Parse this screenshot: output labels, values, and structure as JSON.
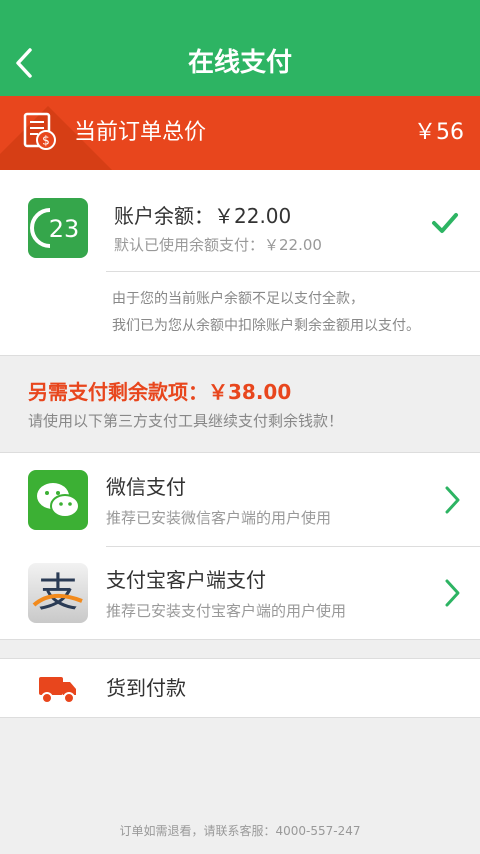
{
  "header": {
    "title": "在线支付"
  },
  "order": {
    "label": "当前订单总价",
    "amount": "￥56"
  },
  "balance": {
    "line1": "账户余额：￥22.00",
    "line2": "默认已使用余额支付：￥22.00",
    "note1": "由于您的当前账户余额不足以支付全款，",
    "note2": "我们已为您从余额中扣除账户剩余金额用以支付。"
  },
  "remaining": {
    "title": "另需支付剩余款项：￥38.00",
    "subtitle": "请使用以下第三方支付工具继续支付剩余钱款！"
  },
  "payment_methods": [
    {
      "name": "微信支付",
      "desc": "推荐已安装微信客户端的用户使用"
    },
    {
      "name": "支付宝客户端支付",
      "desc": "推荐已安装支付宝客户端的用户使用"
    }
  ],
  "cod": {
    "label": "货到付款"
  },
  "footer": {
    "text": "订单如需退看，请联系客服：4000-557-247"
  },
  "colors": {
    "primary_green": "#2db463",
    "accent_orange": "#e8461d"
  },
  "icons": [
    "back-arrow-icon",
    "receipt-icon",
    "balance-23-icon",
    "check-icon",
    "wechat-icon",
    "alipay-icon",
    "chevron-right-icon",
    "truck-icon"
  ]
}
